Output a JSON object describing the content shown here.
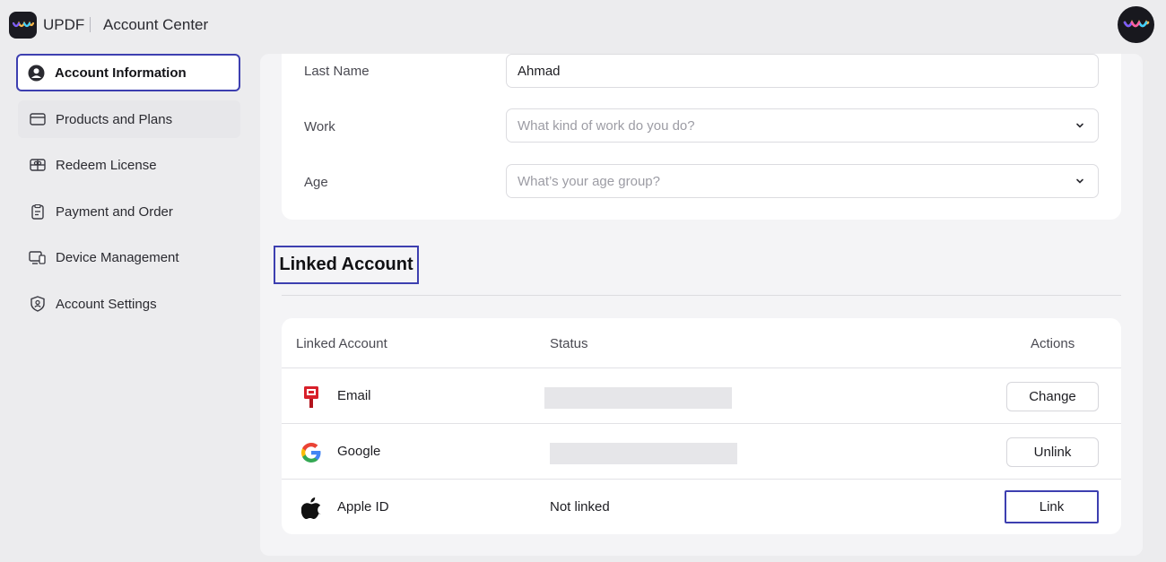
{
  "header": {
    "brand": "UPDF",
    "title": "Account Center"
  },
  "sidebar": {
    "items": [
      {
        "label": "Account Information",
        "icon": "user-circle-icon",
        "active": true
      },
      {
        "label": "Products and Plans",
        "icon": "credit-card-icon"
      },
      {
        "label": "Redeem License",
        "icon": "gift-card-icon"
      },
      {
        "label": "Payment and Order",
        "icon": "receipt-icon"
      },
      {
        "label": "Device Management",
        "icon": "devices-icon"
      },
      {
        "label": "Account Settings",
        "icon": "shield-user-icon"
      }
    ]
  },
  "profile": {
    "last_name_label": "Last Name",
    "last_name_value": "Ahmad",
    "work_label": "Work",
    "work_placeholder": "What kind of work do you do?",
    "age_label": "Age",
    "age_placeholder": "What’s your age group?"
  },
  "linked": {
    "title": "Linked Account",
    "columns": [
      "Linked Account",
      "Status",
      "Actions"
    ],
    "rows": [
      {
        "name": "Email",
        "icon": "email-mailbox-icon",
        "status": "",
        "action": "Change"
      },
      {
        "name": "Google",
        "icon": "google-icon",
        "status": "",
        "action": "Unlink"
      },
      {
        "name": "Apple ID",
        "icon": "apple-icon",
        "status": "Not linked",
        "action": "Link"
      }
    ]
  },
  "colors": {
    "highlight": "#3d3fb0",
    "background": "#ececee",
    "card": "#ffffff"
  }
}
